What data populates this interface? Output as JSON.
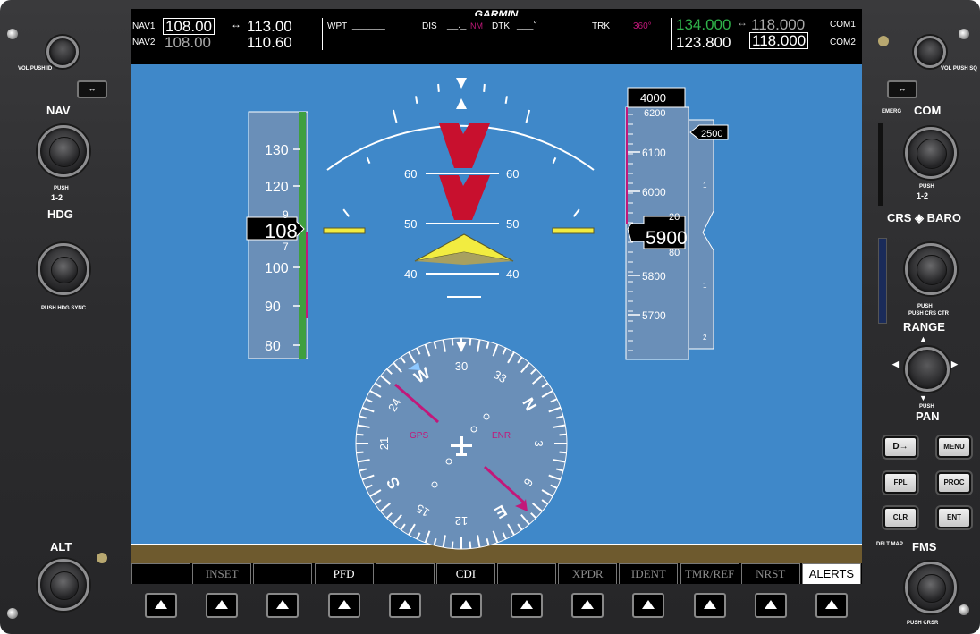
{
  "brand": "GARMIN",
  "left_panel": {
    "vol_label": "VOL",
    "push_id_label": "PUSH ID",
    "swap_icon": "↔",
    "nav_label": "NAV",
    "push_label": "PUSH",
    "nav_12": "1-2",
    "hdg_label": "HDG",
    "hdg_sync_label": "PUSH HDG SYNC",
    "alt_label": "ALT"
  },
  "right_panel": {
    "vol_label": "VOL",
    "push_sq_label": "PUSH SQ",
    "emerg_label": "EMERG",
    "com_label": "COM",
    "push_label": "PUSH",
    "com_12": "1-2",
    "crs_baro_label": "CRS ◈ BARO",
    "push_crs_ctr": "PUSH CRS CTR",
    "range_label": "RANGE",
    "push_pan_label": "PUSH",
    "pan_label": "PAN",
    "direct_label": "D→",
    "menu_label": "MENU",
    "fpl_label": "FPL",
    "proc_label": "PROC",
    "clr_label": "CLR",
    "ent_label": "ENT",
    "dflt_map_label": "DFLT MAP",
    "fms_label": "FMS",
    "push_crsr_label": "PUSH CRSR"
  },
  "topbar": {
    "nav1_label": "NAV1",
    "nav1_active": "108.00",
    "nav1_standby": "113.00",
    "nav2_label": "NAV2",
    "nav2_active": "108.00",
    "nav2_standby": "110.60",
    "wpt_label": "WPT",
    "wpt_value": "______",
    "dis_label": "DIS",
    "dis_value": "__._",
    "dis_unit": "NM",
    "dtk_label": "DTK",
    "dtk_value": "___°",
    "trk_label": "TRK",
    "trk_value": "360°",
    "com1_active": "134.000",
    "com1_standby": "118.000",
    "com1_label": "COM1",
    "com2_active": "123.800",
    "com2_standby": "118.000",
    "com2_label": "COM2",
    "swap_arrow": "↔"
  },
  "airspeed": {
    "ticks": [
      "130",
      "120",
      "100",
      "90",
      "80"
    ],
    "current": "108",
    "roll_top": "9",
    "roll_bottom": "7"
  },
  "attitude": {
    "pitch_labels": [
      "60",
      "60",
      "50",
      "50",
      "40",
      "40"
    ]
  },
  "altimeter": {
    "selected": "4000",
    "top_partial": "6200",
    "ticks": [
      "6100",
      "6000",
      "5800",
      "5700"
    ],
    "current": "5900",
    "roll_top": "20",
    "roll_bottom": "80",
    "vsi_bug": "2500",
    "vsi_marks": [
      "1",
      "1",
      "2"
    ]
  },
  "hsi": {
    "labels": [
      "N",
      "3",
      "6",
      "E",
      "12",
      "15",
      "S",
      "21",
      "24",
      "W",
      "30",
      "33"
    ],
    "gps_label": "GPS",
    "enr_label": "ENR"
  },
  "softkeys": [
    "",
    "INSET",
    "",
    "PFD",
    "",
    "CDI",
    "",
    "XPDR",
    "IDENT",
    "TMR/REF",
    "NRST",
    "ALERTS"
  ],
  "softkey_states": [
    "blank",
    "dim",
    "blank",
    "active",
    "blank",
    "active",
    "blank",
    "dim",
    "dim",
    "dim",
    "dim",
    "alert"
  ],
  "colors": {
    "sky": "#3f88c9",
    "ground": "#6e5a2e",
    "magenta": "#c2187a",
    "cyan": "#00ffff",
    "green_freq": "#2fb24a",
    "chevron_red": "#c8102e",
    "aircraft_yellow": "#f2ec40"
  }
}
